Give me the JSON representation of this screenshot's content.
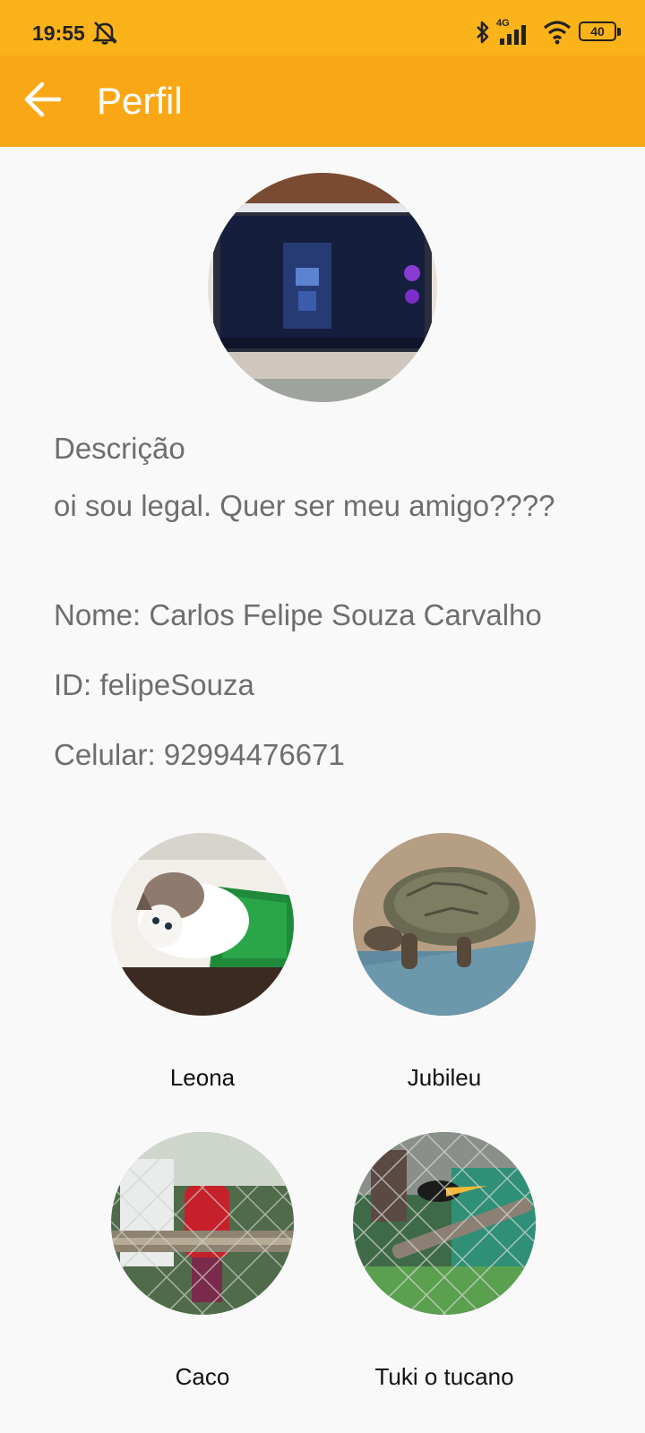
{
  "status_bar": {
    "time": "19:55",
    "network": "4G",
    "battery": "40",
    "icons": [
      "mute-alarm-icon",
      "bluetooth-icon",
      "signal-icon",
      "wifi-icon",
      "battery-icon"
    ]
  },
  "header": {
    "back_icon": "arrow-left-icon",
    "title": "Perfil"
  },
  "profile": {
    "description_label": "Descrição",
    "description_text": "oi sou legal. Quer ser meu amigo????",
    "name_line": "Nome: Carlos Felipe Souza Carvalho",
    "id_line": "ID: felipeSouza",
    "phone_line": "Celular: 92994476671"
  },
  "pets": [
    {
      "name": "Leona"
    },
    {
      "name": "Jubileu"
    },
    {
      "name": "Caco"
    },
    {
      "name": "Tuki o tucano"
    }
  ],
  "colors": {
    "status_bar": "#fbb31a",
    "app_bar": "#faa716",
    "background": "#f9f9f9",
    "text": "#6e6e6e"
  }
}
